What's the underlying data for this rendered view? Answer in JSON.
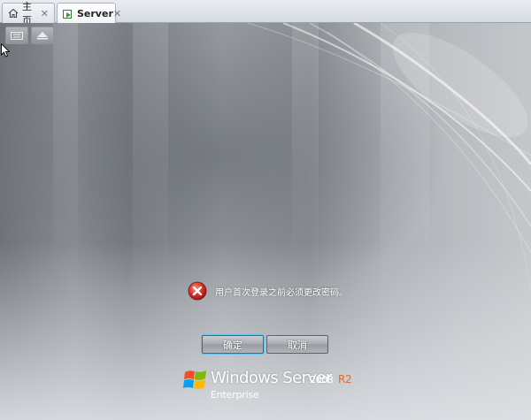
{
  "tabs": [
    {
      "label": "主页",
      "icon": "home-icon",
      "active": false
    },
    {
      "label": "Server",
      "icon": "vm-icon",
      "active": true
    }
  ],
  "tab_close_glyph": "✕",
  "dialog": {
    "message": "用户首次登录之前必须更改密码。",
    "ok_label": "确定",
    "cancel_label": "取消"
  },
  "logo": {
    "product": "Windows Server",
    "version": "2008",
    "edition_mark": "R2",
    "edition": "Enterprise"
  },
  "colors": {
    "error_red": "#d6302a",
    "edition_orange": "#e36a2a",
    "focus_ring": "#5fc4e8"
  }
}
